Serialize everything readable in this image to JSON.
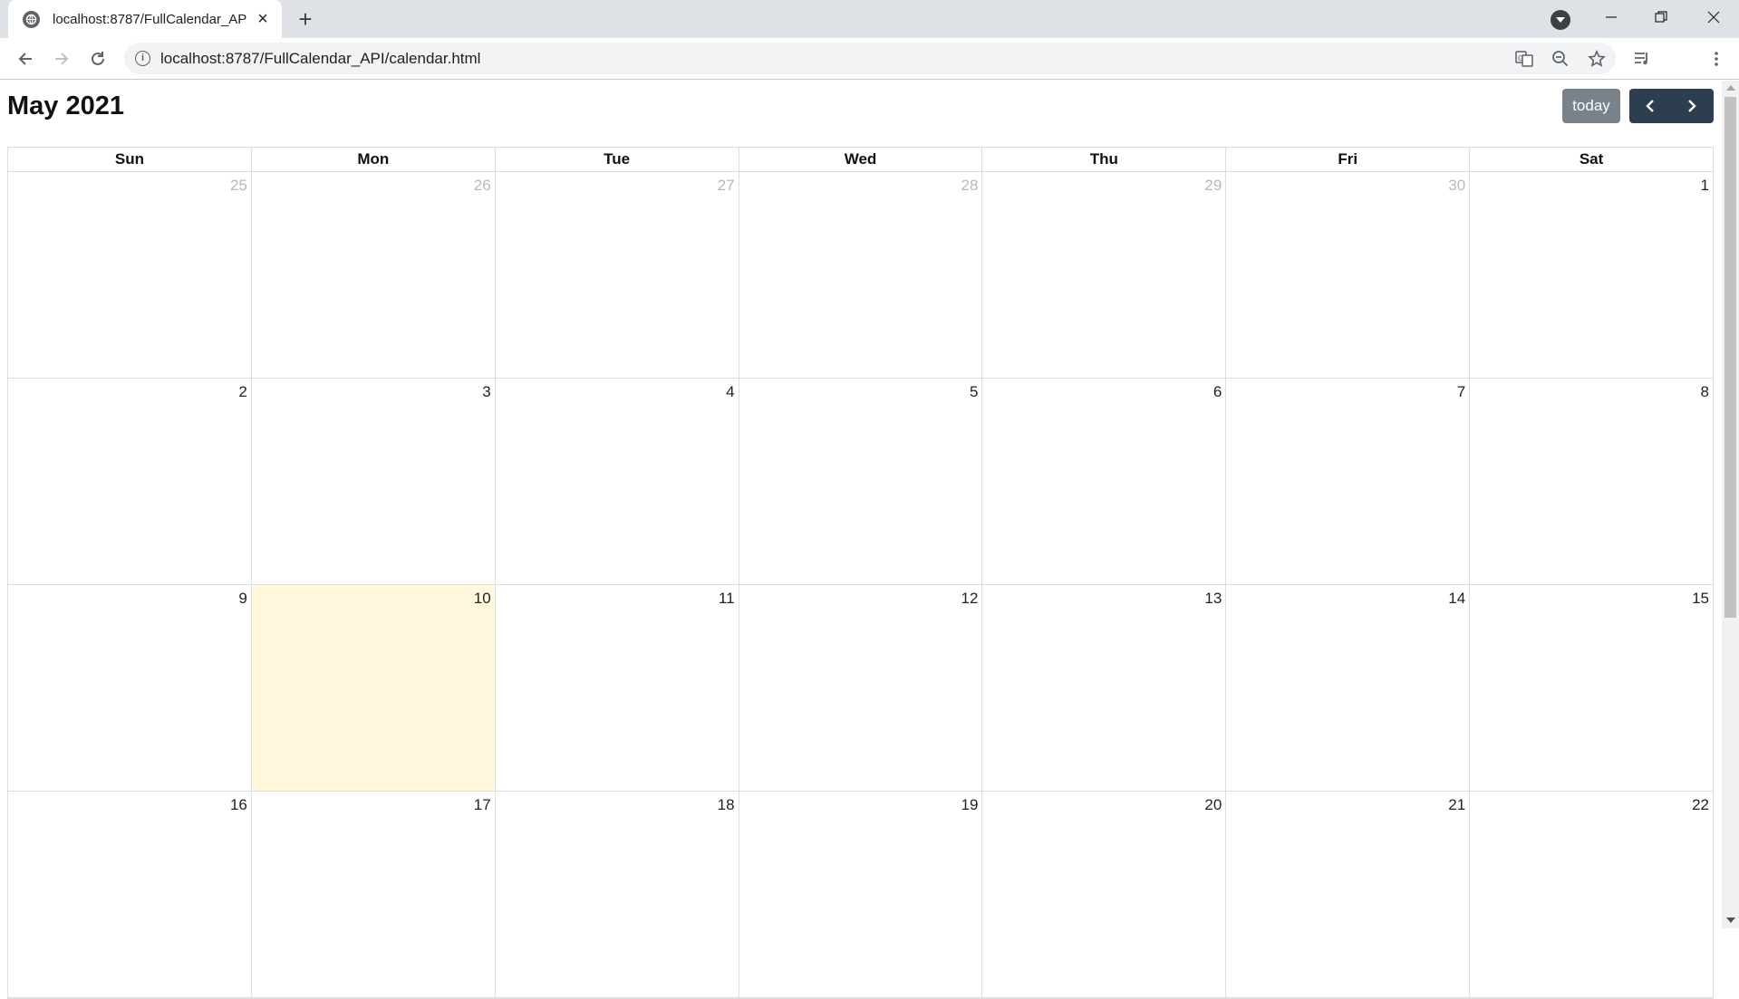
{
  "browser": {
    "tab_title": "localhost:8787/FullCalendar_API/calendar.html",
    "url": "localhost:8787/FullCalendar_API/calendar.html"
  },
  "calendar": {
    "title": "May 2021",
    "today_label": "today",
    "weekdays": [
      "Sun",
      "Mon",
      "Tue",
      "Wed",
      "Thu",
      "Fri",
      "Sat"
    ],
    "weeks": [
      [
        {
          "d": "25",
          "other": true
        },
        {
          "d": "26",
          "other": true
        },
        {
          "d": "27",
          "other": true
        },
        {
          "d": "28",
          "other": true
        },
        {
          "d": "29",
          "other": true
        },
        {
          "d": "30",
          "other": true
        },
        {
          "d": "1"
        }
      ],
      [
        {
          "d": "2"
        },
        {
          "d": "3"
        },
        {
          "d": "4"
        },
        {
          "d": "5"
        },
        {
          "d": "6"
        },
        {
          "d": "7"
        },
        {
          "d": "8"
        }
      ],
      [
        {
          "d": "9"
        },
        {
          "d": "10",
          "today": true
        },
        {
          "d": "11"
        },
        {
          "d": "12"
        },
        {
          "d": "13"
        },
        {
          "d": "14"
        },
        {
          "d": "15"
        }
      ],
      [
        {
          "d": "16"
        },
        {
          "d": "17"
        },
        {
          "d": "18"
        },
        {
          "d": "19"
        },
        {
          "d": "20"
        },
        {
          "d": "21"
        },
        {
          "d": "22"
        }
      ]
    ],
    "colors": {
      "today_bg": "#fff8dc",
      "nav_button": "#2c3e50",
      "today_button": "#6c757d"
    }
  }
}
